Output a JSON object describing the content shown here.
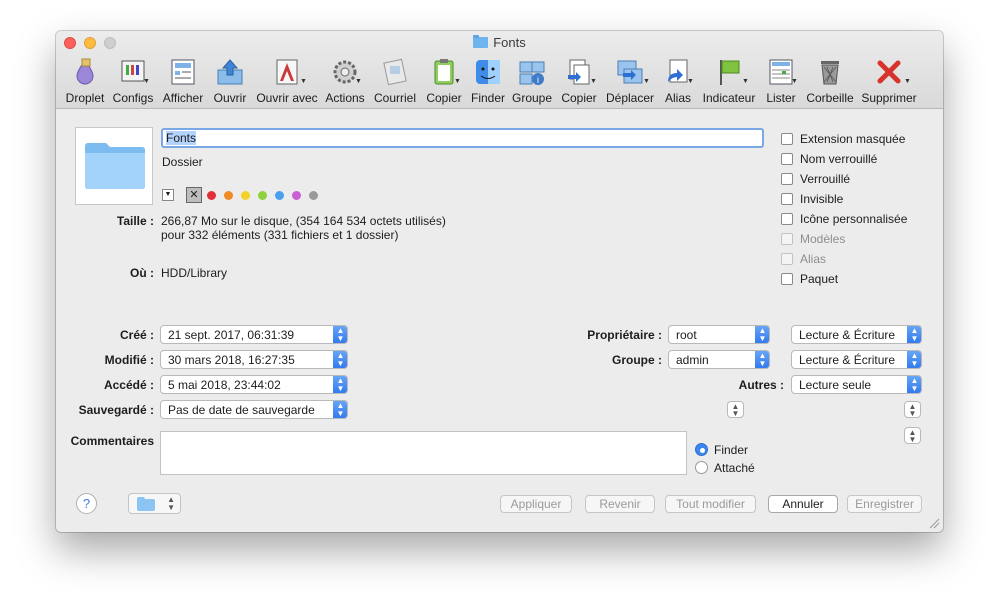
{
  "window": {
    "title": "Fonts"
  },
  "toolbar": [
    {
      "label": "Droplet",
      "icon": "droplet-icon"
    },
    {
      "label": "Configs",
      "icon": "configs-icon"
    },
    {
      "label": "Afficher",
      "icon": "afficher-icon"
    },
    {
      "label": "Ouvrir",
      "icon": "ouvrir-icon"
    },
    {
      "label": "Ouvrir avec",
      "icon": "ouvrir-avec-icon"
    },
    {
      "label": "Actions",
      "icon": "gear-icon"
    },
    {
      "label": "Courriel",
      "icon": "courriel-icon"
    },
    {
      "label": "Copier",
      "icon": "clipboard-icon"
    },
    {
      "label": "Finder",
      "icon": "finder-icon"
    },
    {
      "label": "Groupe",
      "icon": "groupe-icon"
    },
    {
      "label": "Copier",
      "icon": "copy-doc-icon"
    },
    {
      "label": "Déplacer",
      "icon": "deplacer-icon"
    },
    {
      "label": "Alias",
      "icon": "alias-icon"
    },
    {
      "label": "Indicateur",
      "icon": "flag-icon"
    },
    {
      "label": "Lister",
      "icon": "lister-icon"
    },
    {
      "label": "Corbeille",
      "icon": "trash-icon"
    },
    {
      "label": "Supprimer",
      "icon": "delete-x-icon"
    }
  ],
  "item": {
    "name": "Fonts",
    "kind": "Dossier"
  },
  "size": {
    "label": "Taille :",
    "line1": "266,87 Mo sur le disque, (354 164 534 octets utilisés)",
    "line2": "pour 332 éléments (331 fichiers et 1 dossier)"
  },
  "where": {
    "label": "Où :",
    "value": "HDD/Library"
  },
  "label_colors": [
    "#e0303a",
    "#f08a24",
    "#f3d02a",
    "#8ed13a",
    "#4aa0ef",
    "#c85fd6",
    "#9a9a9a"
  ],
  "flags": [
    {
      "label": "Extension masquée",
      "enabled": true,
      "checked": false
    },
    {
      "label": "Nom verrouillé",
      "enabled": true,
      "checked": false
    },
    {
      "label": "Verrouillé",
      "enabled": true,
      "checked": false
    },
    {
      "label": "Invisible",
      "enabled": true,
      "checked": false
    },
    {
      "label": "Icône personnalisée",
      "enabled": true,
      "checked": false
    },
    {
      "label": "Modèles",
      "enabled": false,
      "checked": false
    },
    {
      "label": "Alias",
      "enabled": false,
      "checked": false
    },
    {
      "label": "Paquet",
      "enabled": true,
      "checked": false
    }
  ],
  "dates": {
    "created_label": "Créé :",
    "created": "21 sept. 2017, 06:31:39",
    "modified_label": "Modifié :",
    "modified": "30 mars 2018, 16:27:35",
    "accessed_label": "Accédé :",
    "accessed": "5 mai 2018, 23:44:02",
    "backup_label": "Sauvegardé :",
    "backup": "Pas de date de sauvegarde"
  },
  "permissions": {
    "owner_label": "Propriétaire :",
    "owner": "root",
    "owner_perm": "Lecture & Écriture",
    "group_label": "Groupe :",
    "group": "admin",
    "group_perm": "Lecture & Écriture",
    "others_label": "Autres :",
    "others_perm": "Lecture seule"
  },
  "comments": {
    "label": "Commentaires",
    "value": "",
    "options": [
      "Finder",
      "Attaché"
    ],
    "selected": "Finder"
  },
  "footer": {
    "help": "?",
    "apply": "Appliquer",
    "revert": "Revenir",
    "modify_all": "Tout modifier",
    "cancel": "Annuler",
    "save": "Enregistrer"
  },
  "accent": "#3b86f0"
}
